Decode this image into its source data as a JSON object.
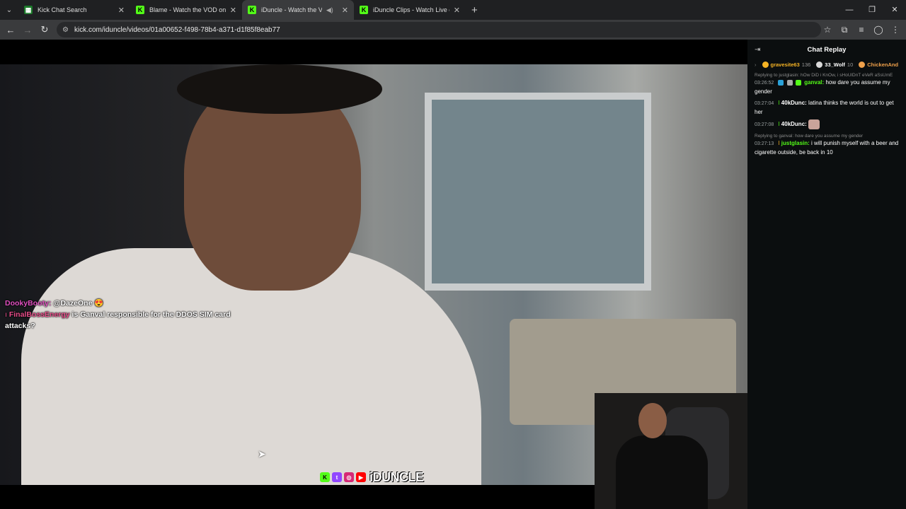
{
  "browser": {
    "tabs": [
      {
        "title": "Kick Chat Search",
        "active": false
      },
      {
        "title": "Blame - Watch the VOD on Kick",
        "active": false
      },
      {
        "title": "iDuncle - Watch the VOD o",
        "active": true
      },
      {
        "title": "iDuncle Clips - Watch Live on K",
        "active": false
      }
    ],
    "url": "kick.com/iduncle/videos/01a00652-f498-78b4-a371-d1f85f8eab77"
  },
  "overlay_chat": [
    {
      "user": "DookyBooty:",
      "text": "@DazeOne 😍"
    },
    {
      "user": "FinalBossEnergy",
      "text": "is Ganval responsible for the DDOS SIM card attacks?"
    }
  ],
  "brand": {
    "name": "iDUNCLE"
  },
  "chat": {
    "title": "Chat Replay",
    "gifters": [
      {
        "name": "gravesite63",
        "count": "136",
        "color": "#f5b324"
      },
      {
        "name": "33_Wolf",
        "count": "10",
        "color": "#d8d8d8"
      },
      {
        "name": "ChickenAnd",
        "count": "",
        "color": "#f0a14b"
      }
    ],
    "messages": [
      {
        "reply": "Replying to justglasin: hOw DiD i KnOw, i sHoUlDnT eVeR aSsUmE",
        "time": "03:26:52",
        "user": "ganval:",
        "user_color": "#53fc18",
        "text": "how dare you assume my gender"
      },
      {
        "reply": "",
        "time": "03:27:04",
        "user": "40kDunc:",
        "user_color": "#ffffff",
        "text": "latina thinks the world is out to get her"
      },
      {
        "reply": "",
        "time": "03:27:08",
        "user": "40kDunc:",
        "user_color": "#ffffff",
        "text": ""
      },
      {
        "reply": "Replying to ganval: how dare you assume my gender",
        "time": "03:27:13",
        "user": "justglasin:",
        "user_color": "#53fc18",
        "text": "i will punish myself with a beer and cigarette outside, be back in 10"
      }
    ]
  }
}
